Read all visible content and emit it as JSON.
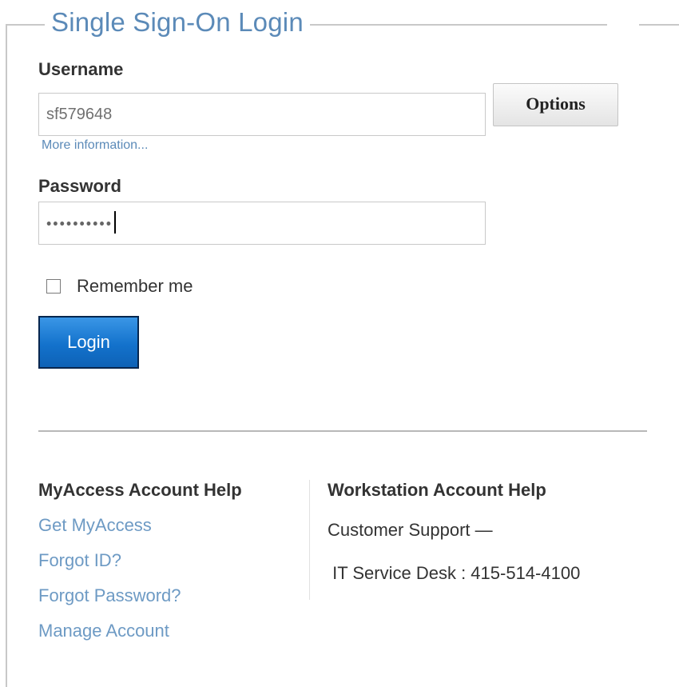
{
  "login": {
    "title": "Single Sign-On Login",
    "username_label": "Username",
    "username_value": "sf579648",
    "options_label": "Options",
    "more_info": "More information...",
    "password_label": "Password",
    "password_mask": "••••••••••",
    "remember_label": "Remember me",
    "remember_checked": false,
    "login_label": "Login"
  },
  "help": {
    "myaccess": {
      "title": "MyAccess Account Help",
      "links": [
        "Get MyAccess",
        "Forgot ID?",
        "Forgot Password?",
        "Manage Account"
      ]
    },
    "workstation": {
      "title": "Workstation Account Help",
      "support_label": "Customer Support —",
      "desk": " IT Service Desk : 415-514-4100"
    }
  },
  "colors": {
    "title_blue": "#5b8ab8",
    "link_blue": "#6d9ac4",
    "login_button": "#1372cc"
  }
}
